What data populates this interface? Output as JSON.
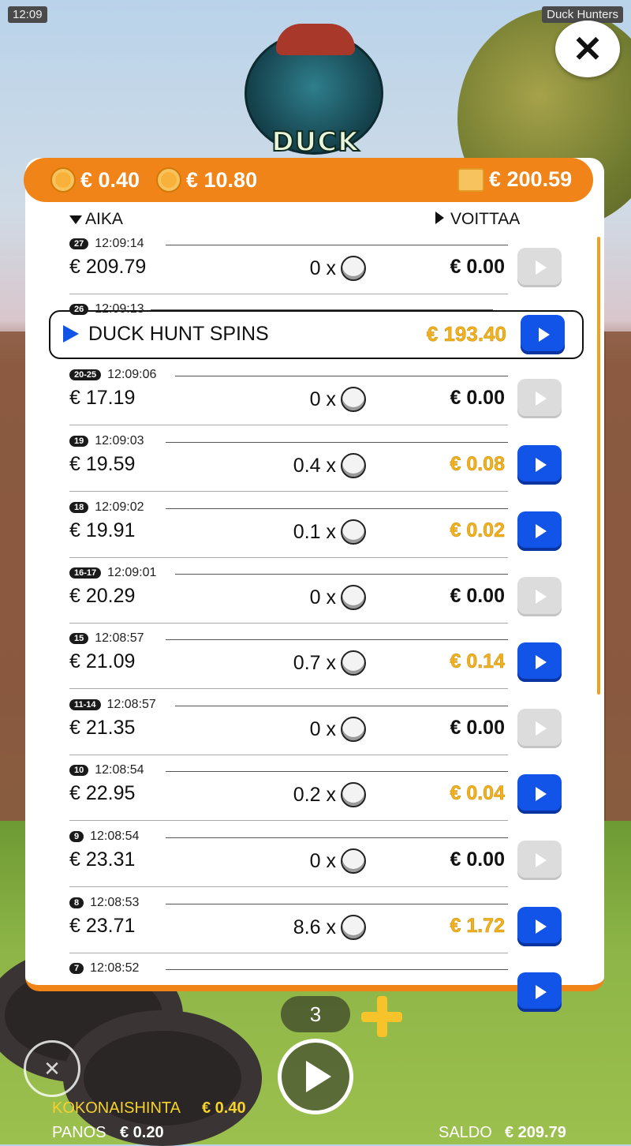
{
  "status": {
    "time": "12:09",
    "app_title": "Duck Hunters"
  },
  "logo": {
    "title": "DUCK HUNTERS"
  },
  "topbar": {
    "bet": "€ 0.40",
    "total_bet": "€ 10.80",
    "balance": "€ 200.59"
  },
  "headers": {
    "time_col": "AIKA",
    "win_col": "VOITTAA"
  },
  "highlight": {
    "idx": "26",
    "time": "12:09:13",
    "label": "DUCK HUNT SPINS",
    "win": "€ 193.40"
  },
  "rows": [
    {
      "idx": "27",
      "time": "12:09:14",
      "balance": "€ 209.79",
      "mult": "0 x",
      "win": "€ 0.00",
      "gold": false,
      "playable": false
    },
    {
      "idx": "20-25",
      "time": "12:09:06",
      "balance": "€ 17.19",
      "mult": "0 x",
      "win": "€ 0.00",
      "gold": false,
      "playable": false
    },
    {
      "idx": "19",
      "time": "12:09:03",
      "balance": "€ 19.59",
      "mult": "0.4 x",
      "win": "€ 0.08",
      "gold": true,
      "playable": true
    },
    {
      "idx": "18",
      "time": "12:09:02",
      "balance": "€ 19.91",
      "mult": "0.1 x",
      "win": "€ 0.02",
      "gold": true,
      "playable": true
    },
    {
      "idx": "16-17",
      "time": "12:09:01",
      "balance": "€ 20.29",
      "mult": "0 x",
      "win": "€ 0.00",
      "gold": false,
      "playable": false
    },
    {
      "idx": "15",
      "time": "12:08:57",
      "balance": "€ 21.09",
      "mult": "0.7 x",
      "win": "€ 0.14",
      "gold": true,
      "playable": true
    },
    {
      "idx": "11-14",
      "time": "12:08:57",
      "balance": "€ 21.35",
      "mult": "0 x",
      "win": "€ 0.00",
      "gold": false,
      "playable": false
    },
    {
      "idx": "10",
      "time": "12:08:54",
      "balance": "€ 22.95",
      "mult": "0.2 x",
      "win": "€ 0.04",
      "gold": true,
      "playable": true
    },
    {
      "idx": "9",
      "time": "12:08:54",
      "balance": "€ 23.31",
      "mult": "0 x",
      "win": "€ 0.00",
      "gold": false,
      "playable": false
    },
    {
      "idx": "8",
      "time": "12:08:53",
      "balance": "€ 23.71",
      "mult": "8.6 x",
      "win": "€ 1.72",
      "gold": true,
      "playable": true
    },
    {
      "idx": "7",
      "time": "12:08:52",
      "balance": "",
      "mult": "",
      "win": "",
      "gold": false,
      "playable": true
    }
  ],
  "controls": {
    "autoplay_count": "3"
  },
  "footer": {
    "total_label": "KOKONAISHINTA",
    "total_value": "€ 0.40",
    "bet_label": "PANOS",
    "bet_value": "€ 0.20",
    "balance_label": "SALDO",
    "balance_value": "€ 209.79"
  },
  "icons": {
    "close": "close-icon",
    "play": "play-icon",
    "coin": "coin-icon",
    "wallet": "wallet-icon",
    "sound": "sound-off-icon",
    "plus": "plus-icon"
  },
  "colors": {
    "accent_orange": "#f08418",
    "play_blue": "#1254e8",
    "win_gold": "#f3b21c"
  }
}
